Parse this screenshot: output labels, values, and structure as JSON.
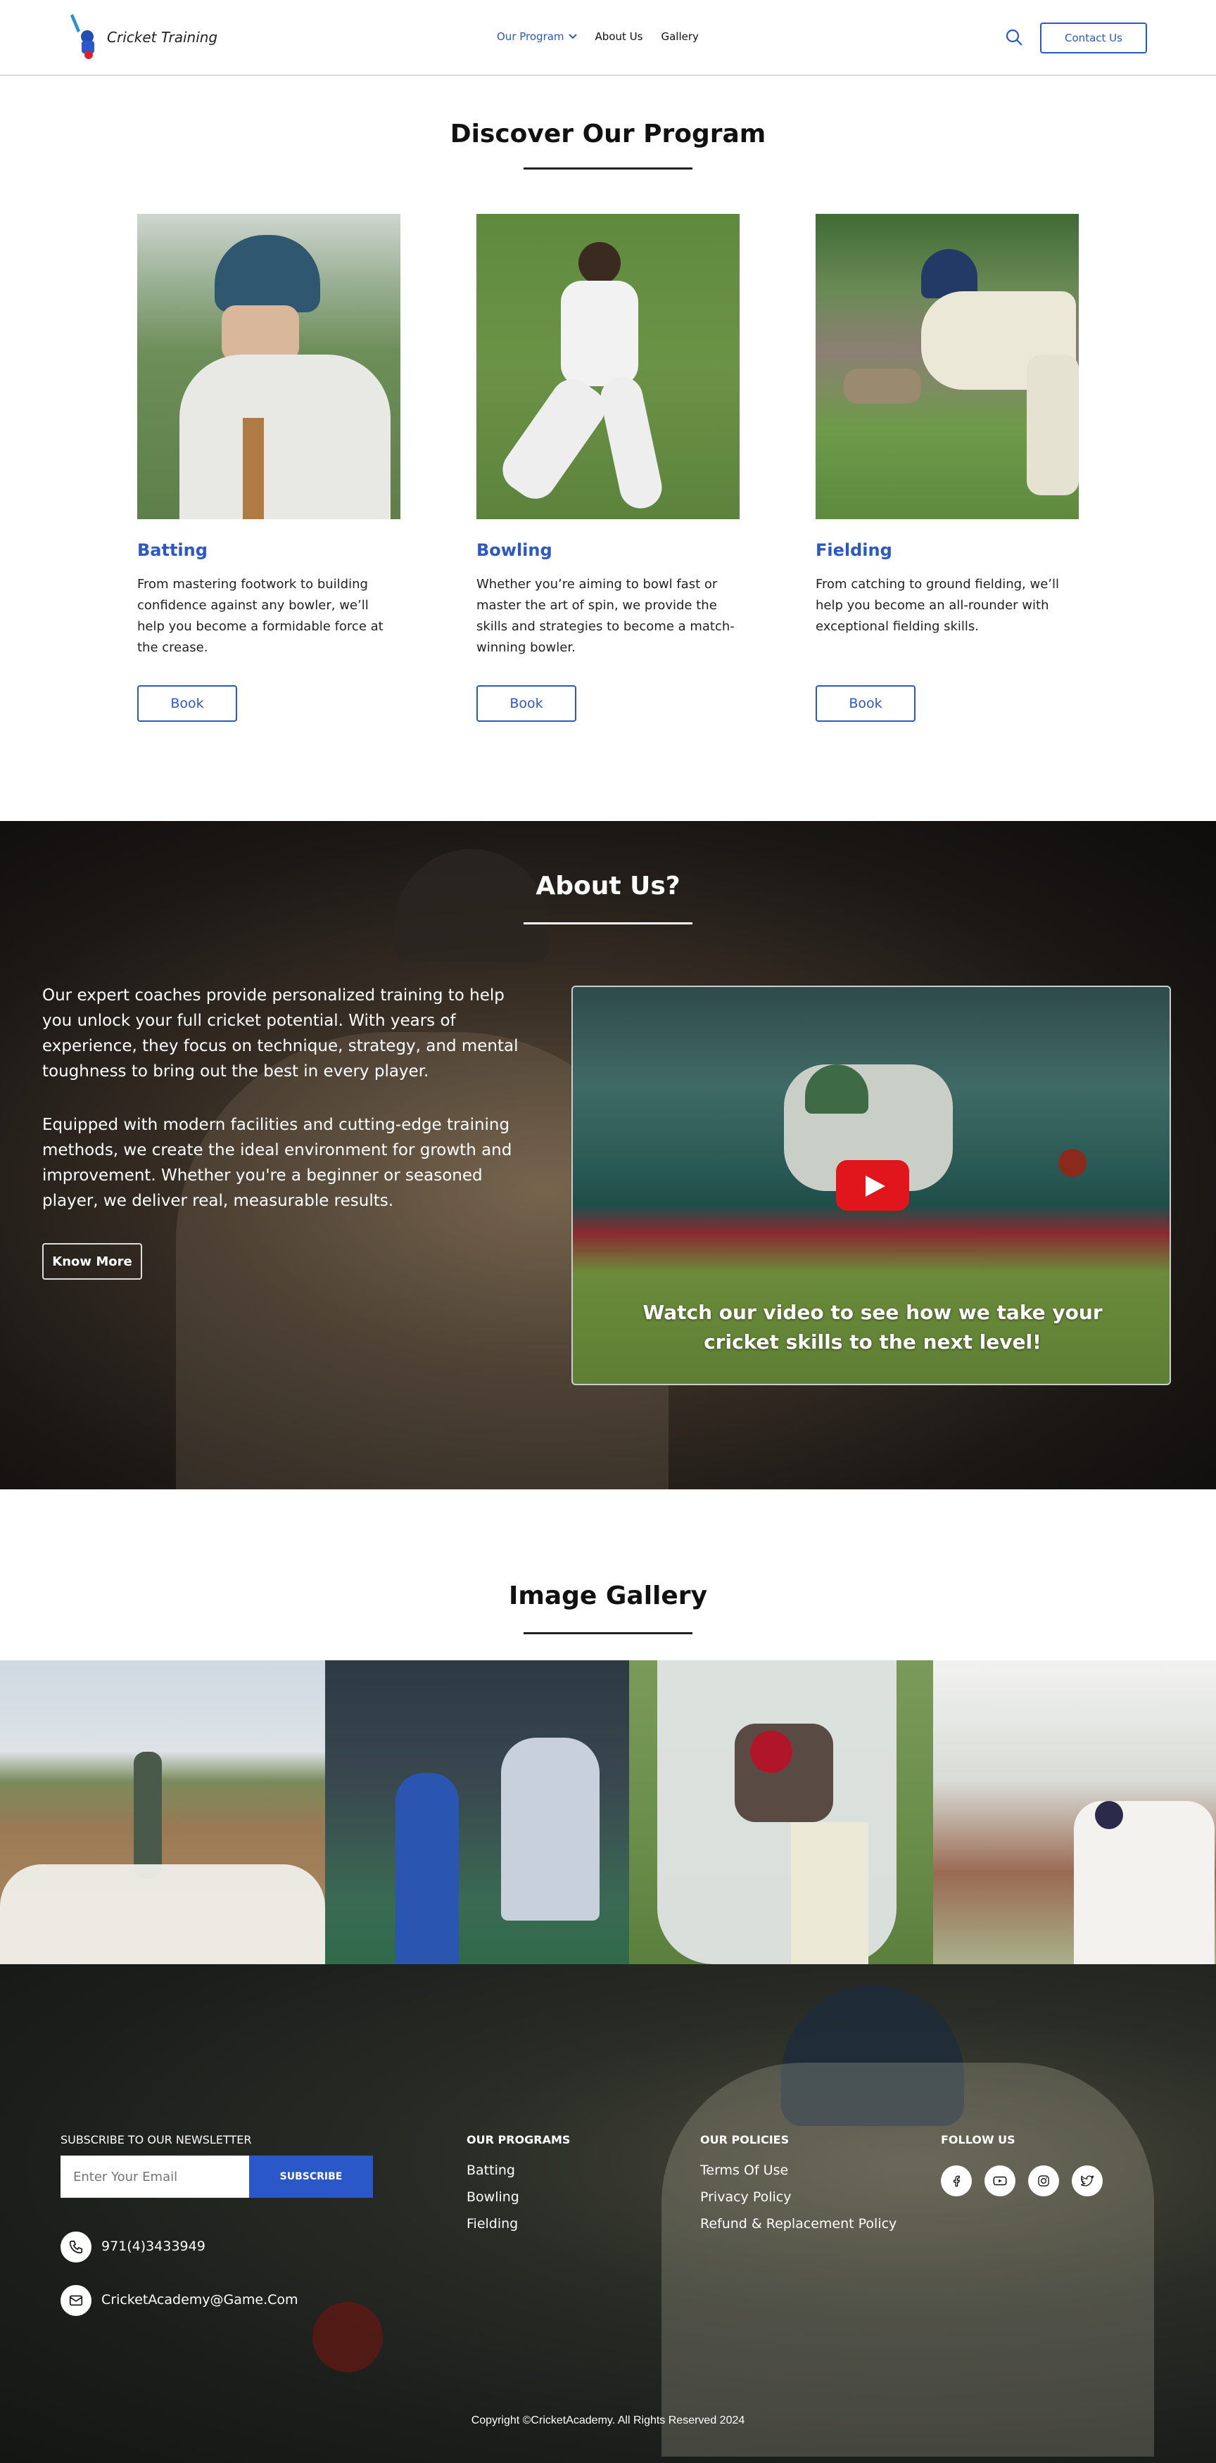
{
  "nav": {
    "brand": "Cricket Training",
    "menu_program": "Our Program",
    "menu_about": "About Us",
    "menu_gallery": "Gallery",
    "contact": "Contact Us"
  },
  "program": {
    "title": "Discover Our Program",
    "cards": [
      {
        "title": "Batting",
        "text": "From mastering footwork to building confidence against any bowler, we’ll help you become a formidable force at the crease.",
        "button": "Book"
      },
      {
        "title": "Bowling",
        "text": "Whether you’re aiming to bowl fast or master the art of spin, we provide the skills and strategies to become a match-winning bowler.",
        "button": "Book"
      },
      {
        "title": "Fielding",
        "text": "From catching to ground fielding, we’ll help you become an all-rounder with exceptional fielding skills.",
        "button": "Book"
      }
    ]
  },
  "about": {
    "title": "About Us?",
    "para1": "Our expert coaches provide personalized training to help you unlock your full cricket potential. With years of experience, they focus on technique, strategy, and mental toughness to bring out the best in every player.",
    "para2": "Equipped with modern facilities and cutting-edge training methods, we create the ideal environment for growth and improvement. Whether you're a beginner or seasoned player, we deliver real, measurable results.",
    "button": "Know More",
    "video_caption": "Watch our video to see how we take your cricket skills to the next level!"
  },
  "gallery": {
    "title": "Image Gallery"
  },
  "footer": {
    "newsletter_heading": "SUBSCRIBE TO OUR NEWSLETTER",
    "email_placeholder": "Enter Your Email",
    "subscribe": "SUBSCRIBE",
    "phone": "971(4)3433949",
    "email": "CricketAcademy@Game.Com",
    "programs_heading": "OUR PROGRAMS",
    "programs": [
      "Batting",
      "Bowling",
      "Fielding"
    ],
    "policies_heading": "OUR POLICIES",
    "policies": [
      "Terms Of Use",
      "Privacy Policy",
      "Refund & Replacement Policy"
    ],
    "follow_heading": "FOLLOW US",
    "copyright": "Copyright ©CricketAcademy. All Rights Reserved 2024"
  },
  "colors": {
    "accent": "#2b58c8",
    "youtube": "#e0161c"
  },
  "icons": [
    "logo-icon",
    "chevron-down-icon",
    "search-icon",
    "play-icon",
    "phone-icon",
    "mail-icon",
    "facebook-icon",
    "youtube-icon",
    "instagram-icon",
    "twitter-icon"
  ]
}
